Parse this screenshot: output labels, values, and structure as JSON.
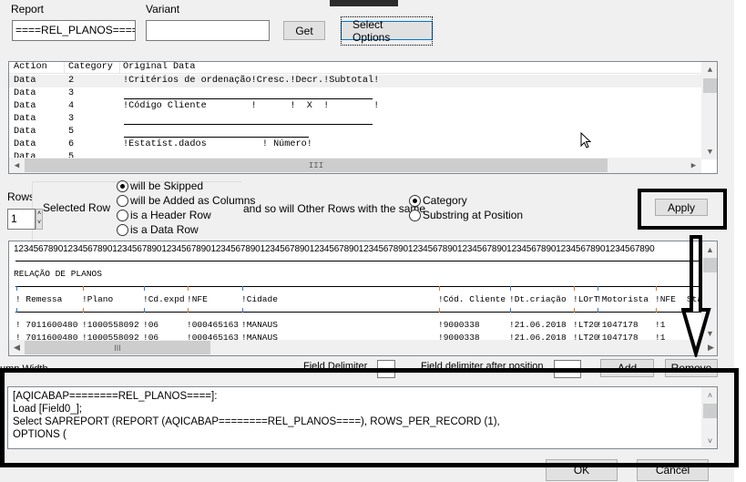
{
  "header": {
    "report_label": "Report",
    "variant_label": "Variant",
    "report_value": "====REL_PLANOS====",
    "variant_value": "",
    "get_label": "Get",
    "select_options_label": "Select Options"
  },
  "grid1": {
    "columns": [
      "Action",
      "Category",
      "Original Data"
    ],
    "rows": [
      {
        "action": "Data",
        "category": "2",
        "data": "!Critérios de ordenação!Cresc.!Decr.!Subtotal!"
      },
      {
        "action": "Data",
        "category": "3",
        "data": ""
      },
      {
        "action": "Data",
        "category": "4",
        "data": "!Código Cliente        !      !  X  !        !"
      },
      {
        "action": "Data",
        "category": "3",
        "data": ""
      },
      {
        "action": "Data",
        "category": "5",
        "data": ""
      },
      {
        "action": "Data",
        "category": "6",
        "data": "!Estatíst.dados          ! Número!"
      },
      {
        "action": "Data",
        "category": "5",
        "data": ""
      }
    ]
  },
  "options": {
    "rows_per_record_label": "Rows per record",
    "rows_per_record_value": "1",
    "selected_row_label": "Selected Row",
    "row_actions": [
      {
        "label": "will be Skipped",
        "checked": true
      },
      {
        "label": "will be Added as Columns",
        "checked": false
      },
      {
        "label": "is a Header Row",
        "checked": false
      },
      {
        "label": "is a Data Row",
        "checked": false
      }
    ],
    "same_label": "and so will Other Rows with the same",
    "match_by": [
      {
        "label": "Category",
        "checked": true
      },
      {
        "label": "Substring at Position",
        "checked": false
      }
    ],
    "apply_label": "Apply"
  },
  "grid2": {
    "ruler": "1234567890123456789012345678901234567890123456789012345678901234567890123456789012345678901234567890123456789012345678901234567890",
    "title": "RELAÇÃO DE PLANOS",
    "headers": [
      "! Remessa",
      "!Plano",
      "!Cd.expd",
      "!NFE",
      "!Cidade",
      "!Cód. Cliente",
      "!Dt.criação",
      "!LOrT",
      "!Motorista",
      "!NFE",
      "Sta"
    ],
    "rows": [
      [
        "! 7011600480",
        "!1000558092",
        "!06",
        "!000465163",
        "!MANAUS",
        "!9000338",
        "!21.06.2018",
        "!LT20",
        "!1047178",
        "!1"
      ],
      [
        "! 7011600480",
        "!1000558092",
        "!06",
        "!000465163",
        "!MANAUS",
        "!9000338",
        "!21.06.2018",
        "!LT20",
        "!1047178",
        "!1"
      ]
    ]
  },
  "fields": {
    "column_width_label": "umn Width",
    "field_delimiter_label": "Field Delimiter",
    "field_delimiter_value": "",
    "after_position_label": "Field delimiter after position",
    "after_position_value": "",
    "add_label": "Add",
    "remove_label": "Remove"
  },
  "script": {
    "lines": [
      "[AQICABAP========REL_PLANOS====]:",
      "Load [Field0_];",
      "Select SAPREPORT (REPORT (AQICABAP========REL_PLANOS====), ROWS_PER_RECORD (1),",
      "OPTIONS ("
    ]
  },
  "footer": {
    "ok_label": "OK",
    "cancel_label": "Cancel"
  }
}
